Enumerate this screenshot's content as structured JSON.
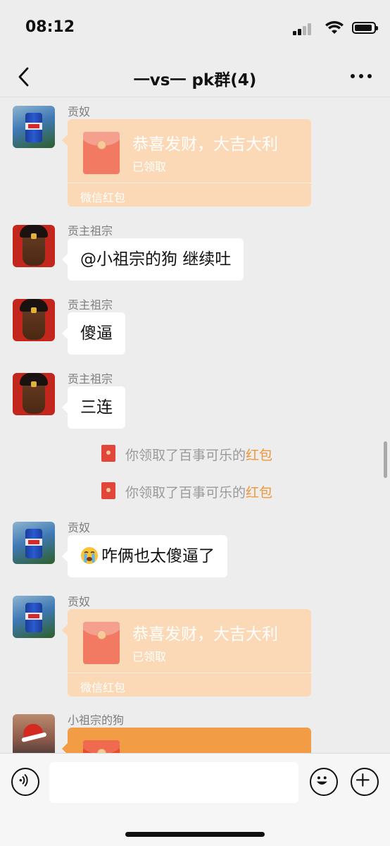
{
  "status_bar": {
    "time": "08:12"
  },
  "nav": {
    "title": "一vs一 pk群(4)"
  },
  "messages": [
    {
      "sender": "贡奴",
      "packet": {
        "title": "恭喜发财，大吉大利",
        "status": "已领取",
        "footer": "微信红包"
      }
    },
    {
      "sender": "贡主祖宗",
      "text": "@小祖宗的狗 继续吐"
    },
    {
      "sender": "贡主祖宗",
      "text": "傻逼"
    },
    {
      "sender": "贡主祖宗",
      "text": "三连"
    },
    {
      "sender": "贡奴",
      "text": "咋俩也太傻逼了",
      "emoji": "crying-face"
    },
    {
      "sender": "贡奴",
      "packet": {
        "title": "恭喜发财，大吉大利",
        "status": "已领取",
        "footer": "微信红包"
      }
    },
    {
      "sender": "小祖宗的狗"
    }
  ],
  "notices": [
    {
      "prefix": "你领取了百事可乐的",
      "link": "红包"
    },
    {
      "prefix": "你领取了百事可乐的",
      "link": "红包"
    }
  ],
  "colors": {
    "background": "#ededed",
    "packet_received": "#fbd9b6",
    "packet_active": "#f29c45",
    "notice_link": "#f0963a"
  },
  "icons": [
    "back-arrow-icon",
    "more-icon",
    "voice-icon",
    "emoji-icon",
    "plus-icon"
  ]
}
